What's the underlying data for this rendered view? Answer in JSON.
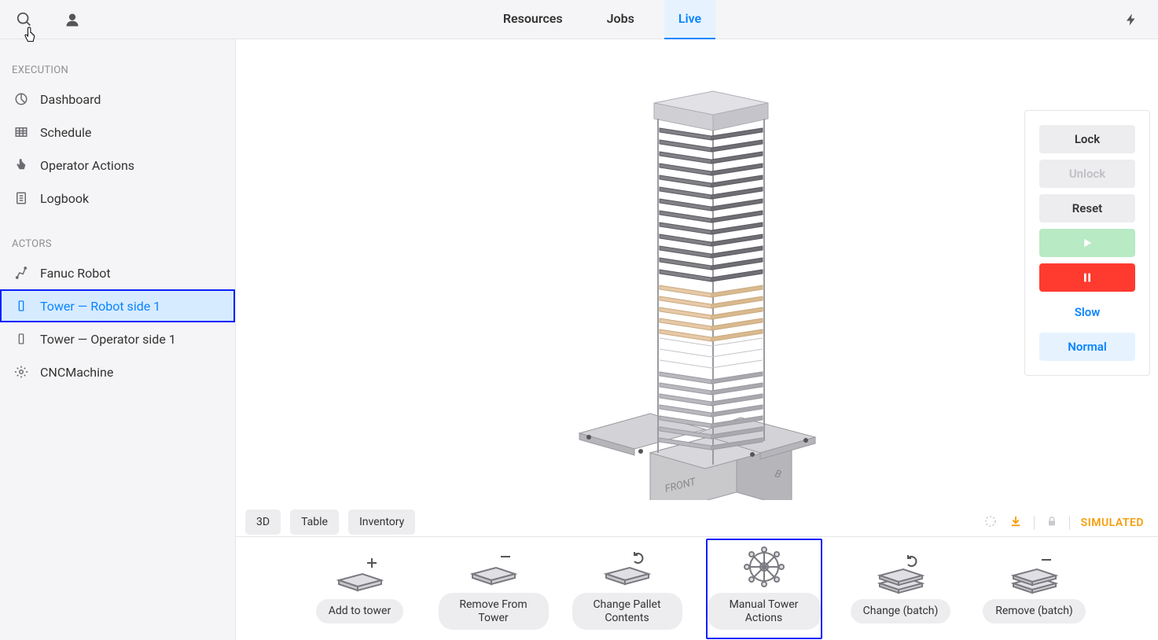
{
  "topbar": {
    "tabs": [
      "Resources",
      "Jobs",
      "Live"
    ],
    "active_tab": "Live"
  },
  "sidebar": {
    "sections": [
      {
        "title": "EXECUTION",
        "items": [
          {
            "label": "Dashboard",
            "icon": "pie"
          },
          {
            "label": "Schedule",
            "icon": "grid"
          },
          {
            "label": "Operator Actions",
            "icon": "hand"
          },
          {
            "label": "Logbook",
            "icon": "log"
          }
        ]
      },
      {
        "title": "ACTORS",
        "items": [
          {
            "label": "Fanuc Robot",
            "icon": "robot"
          },
          {
            "label": "Tower — Robot side 1",
            "icon": "tower",
            "selected": true
          },
          {
            "label": "Tower — Operator side 1",
            "icon": "tower"
          },
          {
            "label": "CNCMachine",
            "icon": "gear"
          }
        ]
      }
    ]
  },
  "view_tabs": [
    "3D",
    "Table",
    "Inventory"
  ],
  "status": {
    "label": "SIMULATED"
  },
  "viz_labels": {
    "front": "FRONT",
    "back": "B"
  },
  "control_panel": {
    "lock": "Lock",
    "unlock": "Unlock",
    "reset": "Reset",
    "slow": "Slow",
    "normal": "Normal"
  },
  "actions": [
    {
      "label": "Add to tower",
      "icon": "add"
    },
    {
      "label": "Remove From Tower",
      "icon": "remove"
    },
    {
      "label": "Change Pallet Contents",
      "icon": "cycle"
    },
    {
      "label": "Manual Tower Actions",
      "icon": "wheel",
      "selected": true
    },
    {
      "label": "Change (batch)",
      "icon": "stack-cycle"
    },
    {
      "label": "Remove (batch)",
      "icon": "stack-remove"
    }
  ]
}
